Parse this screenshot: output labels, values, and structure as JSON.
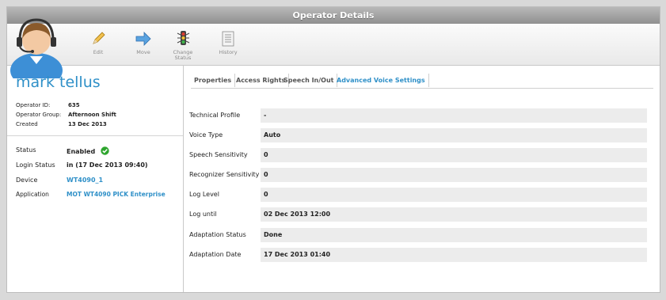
{
  "window": {
    "title": "Operator Details"
  },
  "toolbar": {
    "edit_label": "Edit",
    "move_label": "Move",
    "change_status_label_1": "Change",
    "change_status_label_2": "Status",
    "history_label": "History"
  },
  "operator": {
    "name": "mark tellus",
    "info": [
      {
        "label": "Operator ID:",
        "value": "635"
      },
      {
        "label": "Operator Group:",
        "value": "Afternoon Shift"
      },
      {
        "label": "Created",
        "value": "13 Dec 2013"
      }
    ],
    "status": [
      {
        "label": "Status",
        "value": "Enabled"
      },
      {
        "label": "Login Status",
        "value": "in (17 Dec 2013 09:40)"
      },
      {
        "label": "Device",
        "value": "WT4090_1"
      },
      {
        "label": "Application",
        "value": "MOT WT4090 PICK Enterprise"
      }
    ]
  },
  "tabs": [
    {
      "label": "Properties"
    },
    {
      "label": "Access Rights"
    },
    {
      "label": "Speech In/Out"
    },
    {
      "label": "Advanced Voice Settings"
    }
  ],
  "active_tab": "Advanced Voice Settings",
  "settings": [
    {
      "label": "Technical Profile",
      "value": "-"
    },
    {
      "label": "Voice Type",
      "value": "Auto"
    },
    {
      "label": "Speech Sensitivity",
      "value": "0"
    },
    {
      "label": "Recognizer Sensitivity",
      "value": "0"
    },
    {
      "label": "Log Level",
      "value": "0"
    },
    {
      "label": "Log until",
      "value": "02 Dec 2013 12:00"
    },
    {
      "label": "Adaptation Status",
      "value": "Done"
    },
    {
      "label": "Adaptation Date",
      "value": "17 Dec 2013 01:40"
    }
  ],
  "icons": {
    "avatar": "operator-headset-avatar",
    "edit": "pencil-icon",
    "move": "arrow-right-icon",
    "change_status": "traffic-light-icon",
    "history": "document-list-icon",
    "enabled": "check-circle-icon"
  },
  "colors": {
    "accent": "#2f90c8",
    "enabled_green": "#2ea52e"
  }
}
